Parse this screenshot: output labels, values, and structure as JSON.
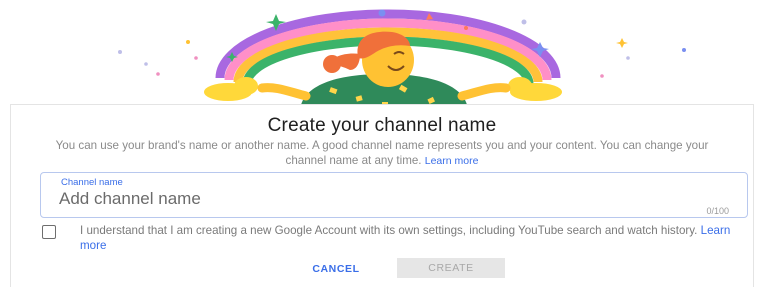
{
  "dialog": {
    "title": "Create your channel name",
    "description": "You can use your brand's name or another name. A good channel name represents you and your content. You can change your channel name at any time.",
    "learn_more": "Learn more"
  },
  "channel_field": {
    "label": "Channel name",
    "placeholder": "Add channel name",
    "value": "",
    "counter": "0/100"
  },
  "consent": {
    "checked": false,
    "text": "I understand that I am creating a new Google Account with its own settings, including YouTube search and watch history.",
    "learn_more": "Learn more"
  },
  "actions": {
    "cancel_label": "CANCEL",
    "create_label": "CREATE"
  },
  "colors": {
    "accent": "#3a6ee8",
    "disabled_bg": "#e6e6e6",
    "disabled_text": "#a8a8a8"
  },
  "illustration": {
    "icon": "rainbow-character-illustration-icon"
  }
}
